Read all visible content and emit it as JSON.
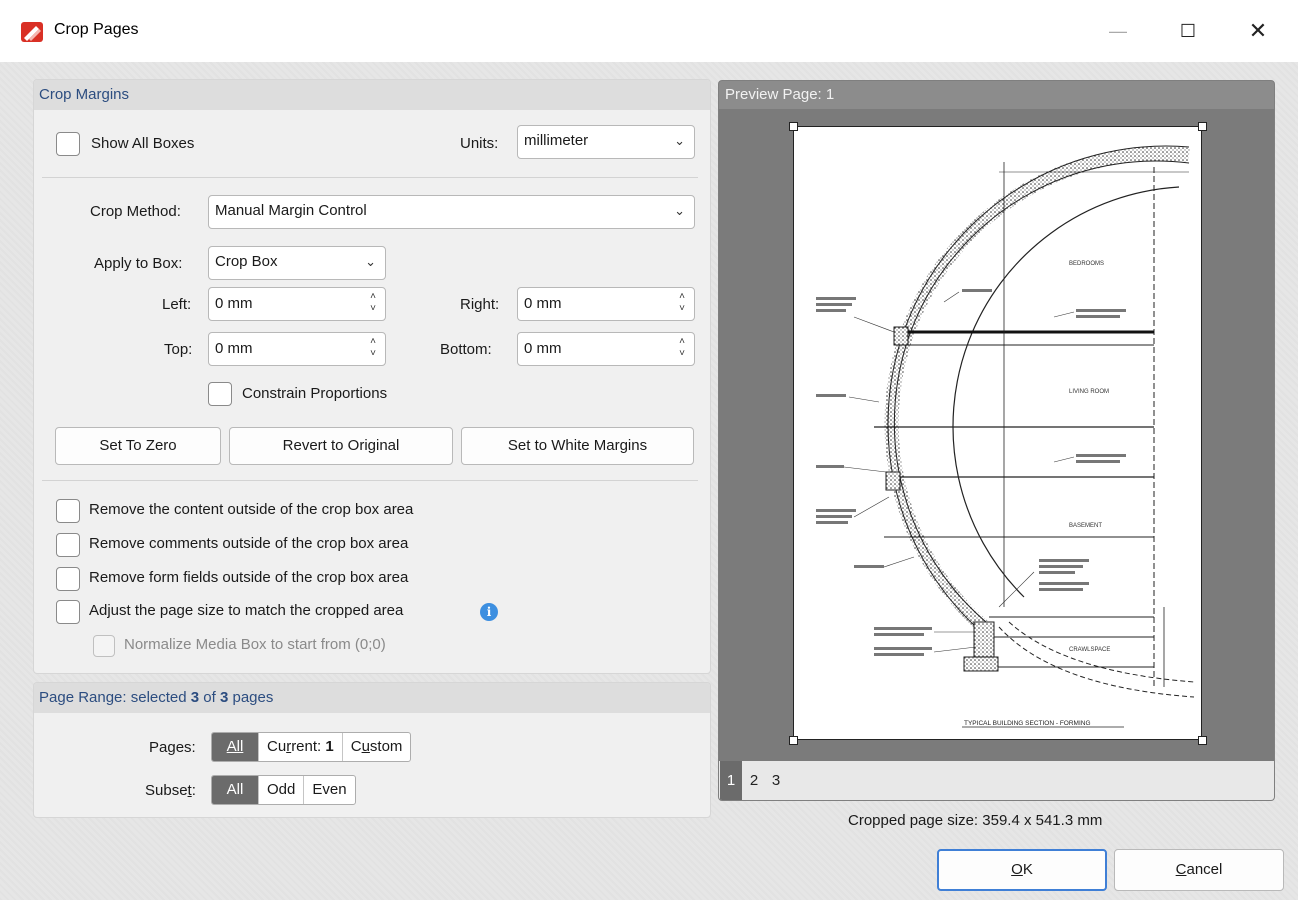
{
  "window": {
    "title": "Crop Pages",
    "minimize_glyph": "—",
    "maximize_glyph": "☐",
    "close_glyph": "✕"
  },
  "crop_margins": {
    "heading": "Crop Margins",
    "show_all_boxes_label": "Show All Boxes",
    "show_all_boxes_checked": false,
    "units_label": "Units:",
    "units_value": "millimeter",
    "crop_method_label": "Crop Method:",
    "crop_method_value": "Manual Margin Control",
    "apply_to_box_label": "Apply to Box:",
    "apply_to_box_value": "Crop Box",
    "left_label": "Left:",
    "left_value": "0 mm",
    "right_label": "Right:",
    "right_value": "0 mm",
    "top_label": "Top:",
    "top_value": "0 mm",
    "bottom_label": "Bottom:",
    "bottom_value": "0 mm",
    "constrain_label": "Constrain Proportions",
    "constrain_checked": false,
    "set_to_zero": "Set To Zero",
    "revert": "Revert to Original",
    "set_white": "Set to White Margins",
    "options": [
      {
        "label": "Remove the content outside of the crop box area",
        "checked": false
      },
      {
        "label": "Remove comments outside of the crop box area",
        "checked": false
      },
      {
        "label": "Remove form fields outside of the crop box area",
        "checked": false
      },
      {
        "label": "Adjust the page size to match the cropped area",
        "checked": false
      }
    ],
    "normalize_label": "Normalize Media Box to start from (0;0)",
    "normalize_enabled": false
  },
  "page_range": {
    "heading_prefix": "Page Range: selected ",
    "selected": "3",
    "heading_of": " of ",
    "total": "3",
    "heading_suffix": " pages",
    "pages_label_pre": "Pa",
    "pages_label_u": "g",
    "pages_label_post": "es:",
    "pages_all": "All",
    "pages_current_pre": "Cu",
    "pages_current_u": "r",
    "pages_current_post": "rent: ",
    "pages_current_num": "1",
    "pages_custom_pre": "C",
    "pages_custom_u": "u",
    "pages_custom_post": "stom",
    "subset_label_pre": "Subse",
    "subset_label_u": "t",
    "subset_label_post": ":",
    "subset_all": "All",
    "subset_odd": "Odd",
    "subset_even": "Even"
  },
  "preview": {
    "heading": "Preview Page: 1",
    "pages": [
      "1",
      "2",
      "3"
    ],
    "active_page": "1",
    "drawing_rooms": [
      "BEDROOMS",
      "LIVING ROOM",
      "BASEMENT",
      "CRAWLSPACE"
    ],
    "drawing_title": "TYPICAL BUILDING SECTION - FORMING",
    "cropped_size": "Cropped page size: 359.4 x 541.3 mm"
  },
  "footer": {
    "ok_u": "O",
    "ok_rest": "K",
    "cancel_u": "C",
    "cancel_rest": "ancel"
  },
  "colors": {
    "accent": "#2c4d80",
    "active_segment": "#6b6b6b",
    "info_icon": "#3d8fe0",
    "app_icon": "#d93025"
  }
}
